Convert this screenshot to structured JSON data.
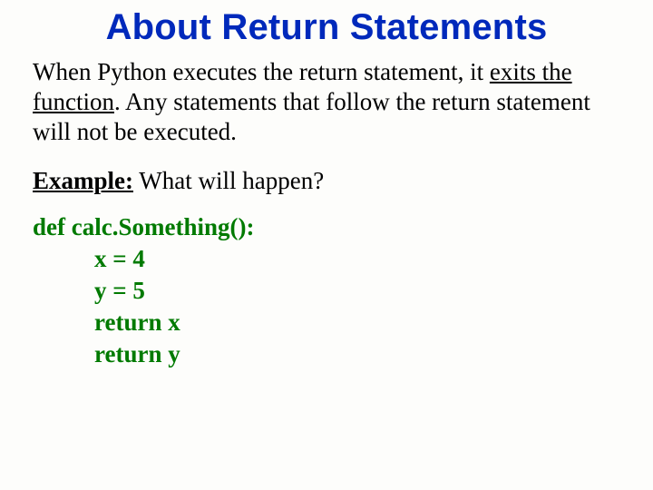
{
  "title": "About Return Statements",
  "paragraph": {
    "part1": "When Python executes the return statement, it ",
    "underlined": "exits the function",
    "part2": ".  Any statements that follow the return statement will not be executed."
  },
  "example": {
    "label": "Example:",
    "question": "  What will happen?"
  },
  "code": {
    "line1": "def calc.Something():",
    "line2": "x = 4",
    "line3": "y = 5",
    "line4": "return x",
    "line5": "return  y"
  }
}
